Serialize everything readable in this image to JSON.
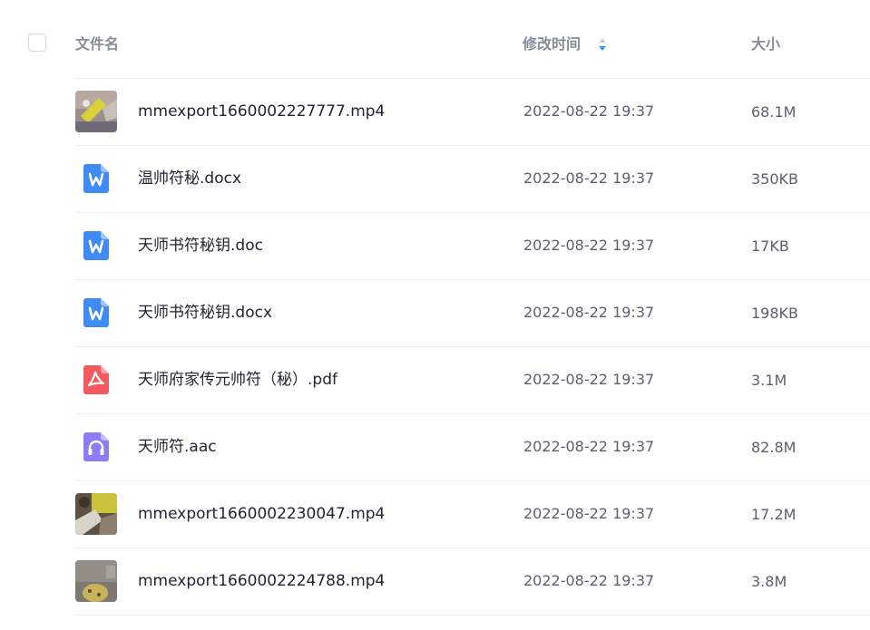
{
  "header": {
    "name_label": "文件名",
    "time_label": "修改时间",
    "size_label": "大小"
  },
  "colors": {
    "word_icon": "#3e8bf5",
    "pdf_icon": "#f3595f",
    "audio_icon": "#8c7cf7",
    "sort_active": "#2d9cf5",
    "sort_inactive": "#c9cdd5",
    "divider": "#eef0f3"
  },
  "files": [
    {
      "name": "mmexport1660002227777.mp4",
      "time": "2022-08-22 19:37",
      "size": "68.1M",
      "type": "video",
      "icon": "video-thumbnail"
    },
    {
      "name": "温帅符秘.docx",
      "time": "2022-08-22 19:37",
      "size": "350KB",
      "type": "word",
      "icon": "word-doc-icon"
    },
    {
      "name": "天师书符秘钥.doc",
      "time": "2022-08-22 19:37",
      "size": "17KB",
      "type": "word",
      "icon": "word-doc-icon"
    },
    {
      "name": "天师书符秘钥.docx",
      "time": "2022-08-22 19:37",
      "size": "198KB",
      "type": "word",
      "icon": "word-doc-icon"
    },
    {
      "name": "天师府家传元帅符（秘）.pdf",
      "time": "2022-08-22 19:37",
      "size": "3.1M",
      "type": "pdf",
      "icon": "pdf-icon"
    },
    {
      "name": "天师符.aac",
      "time": "2022-08-22 19:37",
      "size": "82.8M",
      "type": "audio",
      "icon": "audio-headphones-icon"
    },
    {
      "name": "mmexport1660002230047.mp4",
      "time": "2022-08-22 19:37",
      "size": "17.2M",
      "type": "video",
      "icon": "video-thumbnail"
    },
    {
      "name": "mmexport1660002224788.mp4",
      "time": "2022-08-22 19:37",
      "size": "3.8M",
      "type": "video",
      "icon": "video-thumbnail"
    }
  ]
}
